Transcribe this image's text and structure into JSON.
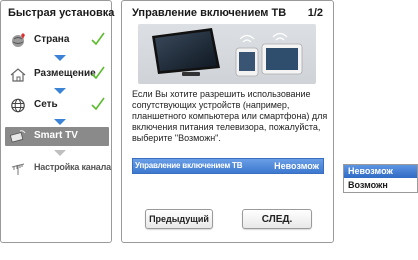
{
  "sidebar": {
    "title": "Быстрая установка",
    "steps": [
      {
        "label": "Страна",
        "icon": "globe-pin-icon",
        "status": "done"
      },
      {
        "label": "Размещение",
        "icon": "home-icon",
        "status": "done"
      },
      {
        "label": "Сеть",
        "icon": "network-globe-icon",
        "status": "done"
      },
      {
        "label": "Smart TV",
        "icon": "smart-tv-icon",
        "status": "current"
      },
      {
        "label": "Настройка канала",
        "icon": "antenna-icon",
        "status": "pending"
      }
    ]
  },
  "main": {
    "title": "Управление включением ТВ",
    "page_indicator": "1/2",
    "description": "Если Вы хотите разрешить использование сопутствующих устройств (например, планшетного компьютера или смартфона) для включения питания телевизора, пожалуйста, выберите \"Возможн\".",
    "setting": {
      "label": "Управление включением ТВ",
      "value": "Невозмож"
    },
    "buttons": {
      "prev": "Предыдущий",
      "next": "СЛЕД."
    }
  },
  "dropdown": {
    "options": [
      "Невозмож",
      "Возможн"
    ],
    "selected": "Невозмож"
  },
  "colors": {
    "accent_blue": "#3a83d6",
    "check_green": "#5cbb2e",
    "current_step_bg": "#8a8a8a"
  }
}
